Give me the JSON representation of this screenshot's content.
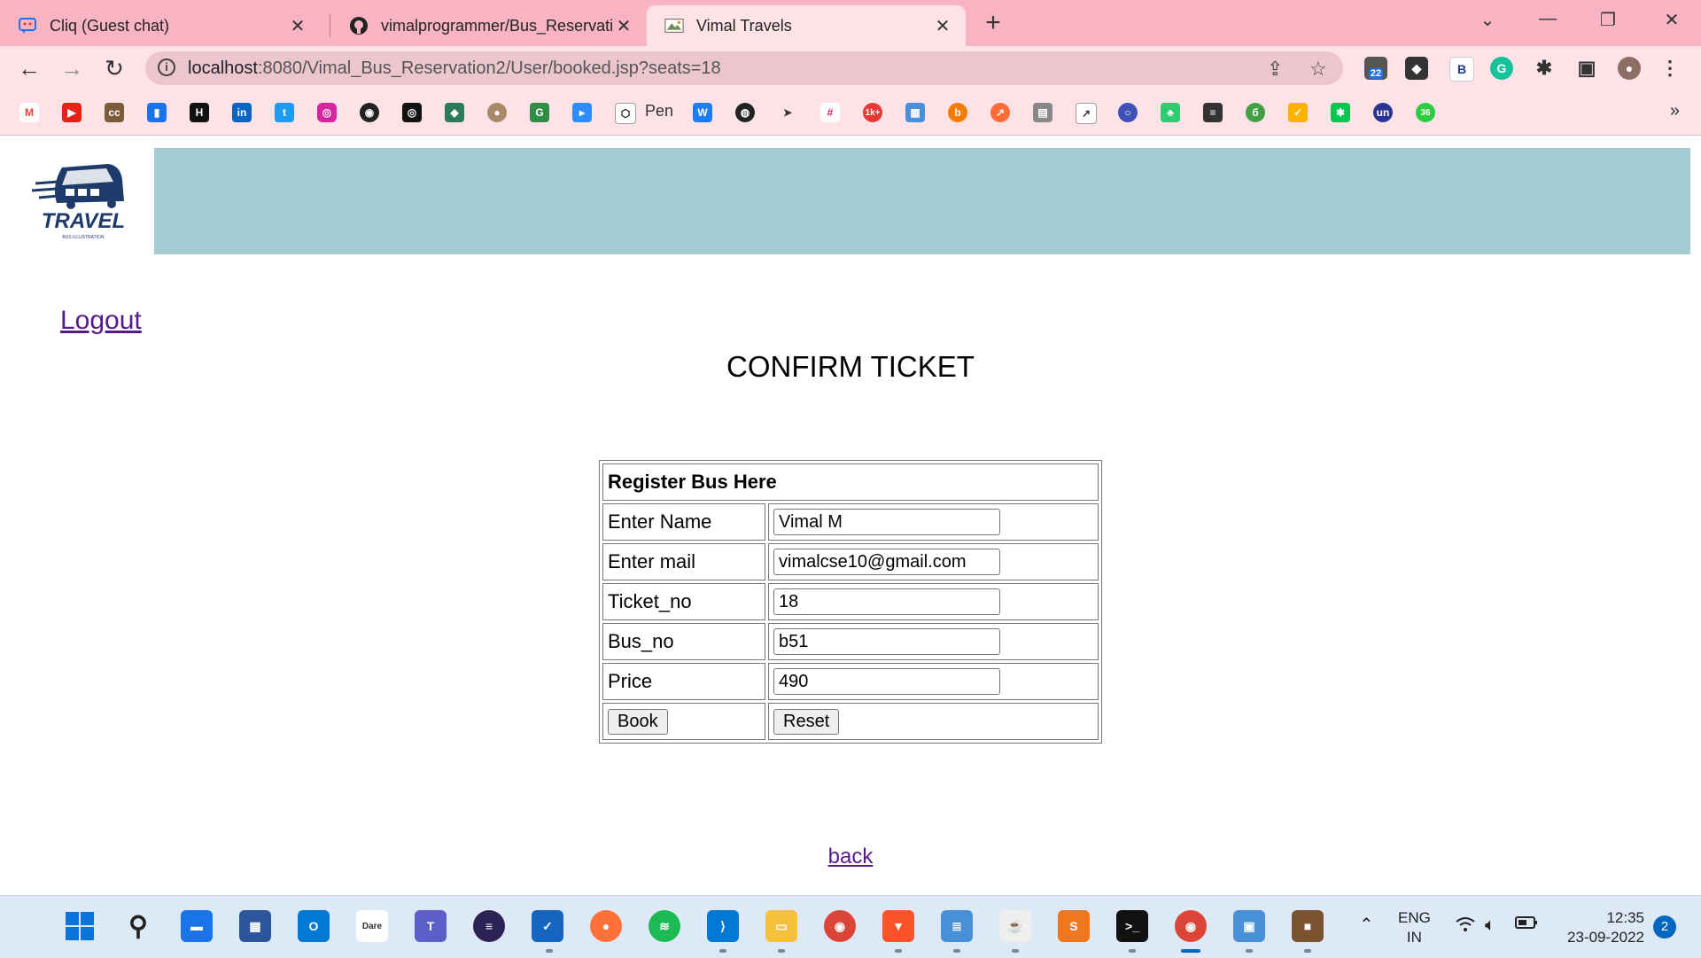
{
  "browser": {
    "tabs": [
      {
        "title": "Cliq (Guest chat)",
        "icon": "cliq-icon"
      },
      {
        "title": "vimalprogrammer/Bus_Reservatio",
        "icon": "github-icon"
      },
      {
        "title": "Vimal Travels",
        "icon": "travel-favicon"
      }
    ],
    "url_host": "localhost",
    "url_path": ":8080/Vimal_Bus_Reservation2/User/booked.jsp?seats=18",
    "ext_badge": "22",
    "bookmark_pen_label": "Pen",
    "bookmarks": [
      "gmail",
      "youtube",
      "cc",
      "charts",
      "hackerrank",
      "linkedin",
      "twitter",
      "instagram",
      "github",
      "codechef",
      "hackerearth",
      "ieee",
      "geeksforgeeks",
      "zoom",
      "codepen",
      "webflow",
      "globe",
      "telegram",
      "slack",
      "1k+",
      "apps",
      "blender",
      "postman",
      "certificate",
      "analytics",
      "circle",
      "tree",
      "ruby",
      "tick",
      "rocket",
      "asterisk",
      "unacademy",
      "36"
    ]
  },
  "page": {
    "logo_text": "TRAVEL",
    "logo_sub": "BUS ILLUSTRATION",
    "logout": "Logout",
    "heading": "CONFIRM TICKET",
    "form": {
      "header": "Register Bus Here",
      "name_label": "Enter Name",
      "name_value": "Vimal M",
      "mail_label": "Enter mail",
      "mail_value": "vimalcse10@gmail.com",
      "ticket_label": "Ticket_no",
      "ticket_value": "18",
      "bus_label": "Bus_no",
      "bus_value": "b51",
      "price_label": "Price",
      "price_value": "490",
      "book_button": "Book",
      "reset_button": "Reset"
    },
    "back_link": "back"
  },
  "taskbar": {
    "lang_top": "ENG",
    "lang_bottom": "IN",
    "time": "12:35",
    "date": "23-09-2022",
    "notifications": "2",
    "dare_label": "Dare",
    "apps": [
      "start",
      "search",
      "desktop",
      "store",
      "outlook",
      "dare2compete",
      "teams",
      "eclipse",
      "whiteboard",
      "firefox",
      "spotify",
      "vscode",
      "explorer",
      "chrome",
      "brave",
      "notepad",
      "java",
      "sublime",
      "terminal",
      "chrome-profile",
      "rdp",
      "minecraft"
    ]
  },
  "colors": {
    "tabbar": "#f8b4c3",
    "toolbar": "#fde2e8",
    "banner": "#a5cbd3",
    "link": "#551a8b"
  }
}
